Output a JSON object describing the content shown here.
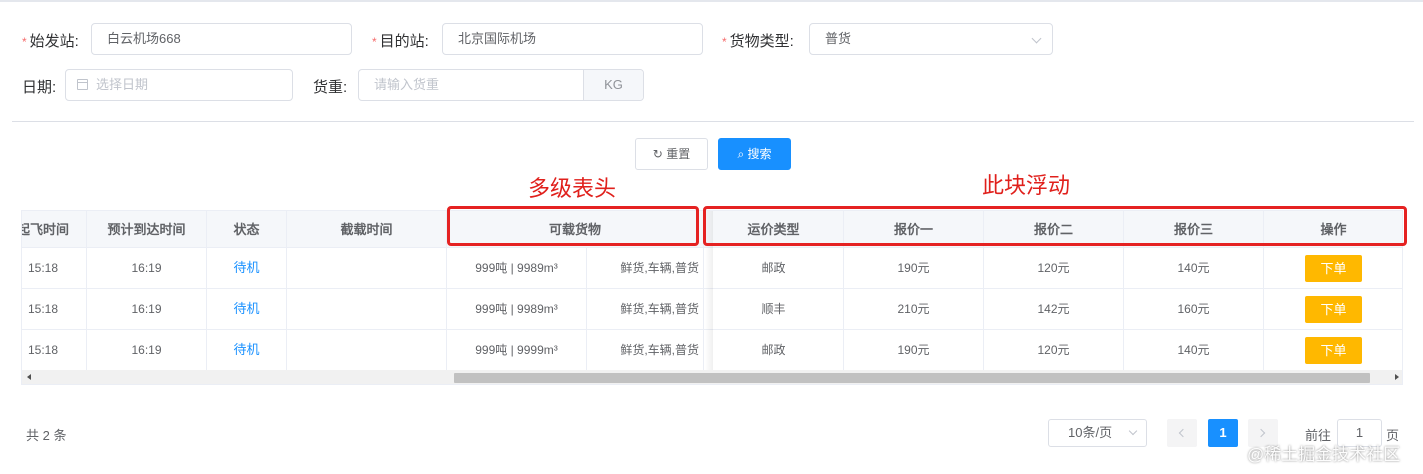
{
  "form": {
    "origin": {
      "label": "始发站:",
      "value": "白云机场668"
    },
    "destination": {
      "label": "目的站:",
      "value": "北京国际机场"
    },
    "cargo_type": {
      "label": "货物类型:",
      "value": "普货"
    },
    "date": {
      "label": "日期:",
      "placeholder": "选择日期"
    },
    "weight": {
      "label": "货重:",
      "placeholder": "请输入货重",
      "unit": "KG"
    },
    "required_mark": "*"
  },
  "buttons": {
    "reset": "重置",
    "search": "搜索"
  },
  "annotations": {
    "multi_header": "多级表头",
    "floating": "此块浮动"
  },
  "table": {
    "headers": [
      "起飞时间",
      "预计到达时间",
      "状态",
      "截载时间",
      "可载货物",
      "运价类型",
      "报价一",
      "报价二",
      "报价三",
      "操作"
    ],
    "rows": [
      {
        "depart": "15:18",
        "arrive": "16:19",
        "status": "待机",
        "cutoff": "",
        "capacity": "999吨 | 9989m³",
        "goods": "鲜货,车辆,普货",
        "price_type": "邮政",
        "p1": "190元",
        "p2": "120元",
        "p3": "140元",
        "action": "下单"
      },
      {
        "depart": "15:18",
        "arrive": "16:19",
        "status": "待机",
        "cutoff": "",
        "capacity": "999吨 | 9989m³",
        "goods": "鲜货,车辆,普货",
        "price_type": "顺丰",
        "p1": "210元",
        "p2": "142元",
        "p3": "160元",
        "action": "下单"
      },
      {
        "depart": "15:18",
        "arrive": "16:19",
        "status": "待机",
        "cutoff": "",
        "capacity": "999吨 | 9999m³",
        "goods": "鲜货,车辆,普货",
        "price_type": "邮政",
        "p1": "190元",
        "p2": "120元",
        "p3": "140元",
        "action": "下单"
      }
    ]
  },
  "pagination": {
    "total": "共 2 条",
    "page_size": "10条/页",
    "current_page": "1",
    "goto_prefix": "前往",
    "goto_value": "1",
    "goto_suffix": "页"
  },
  "watermark": "@稀土掘金技术社区",
  "colors": {
    "primary": "#1890ff",
    "order_button": "#ffb800",
    "annotation": "#e52222"
  }
}
